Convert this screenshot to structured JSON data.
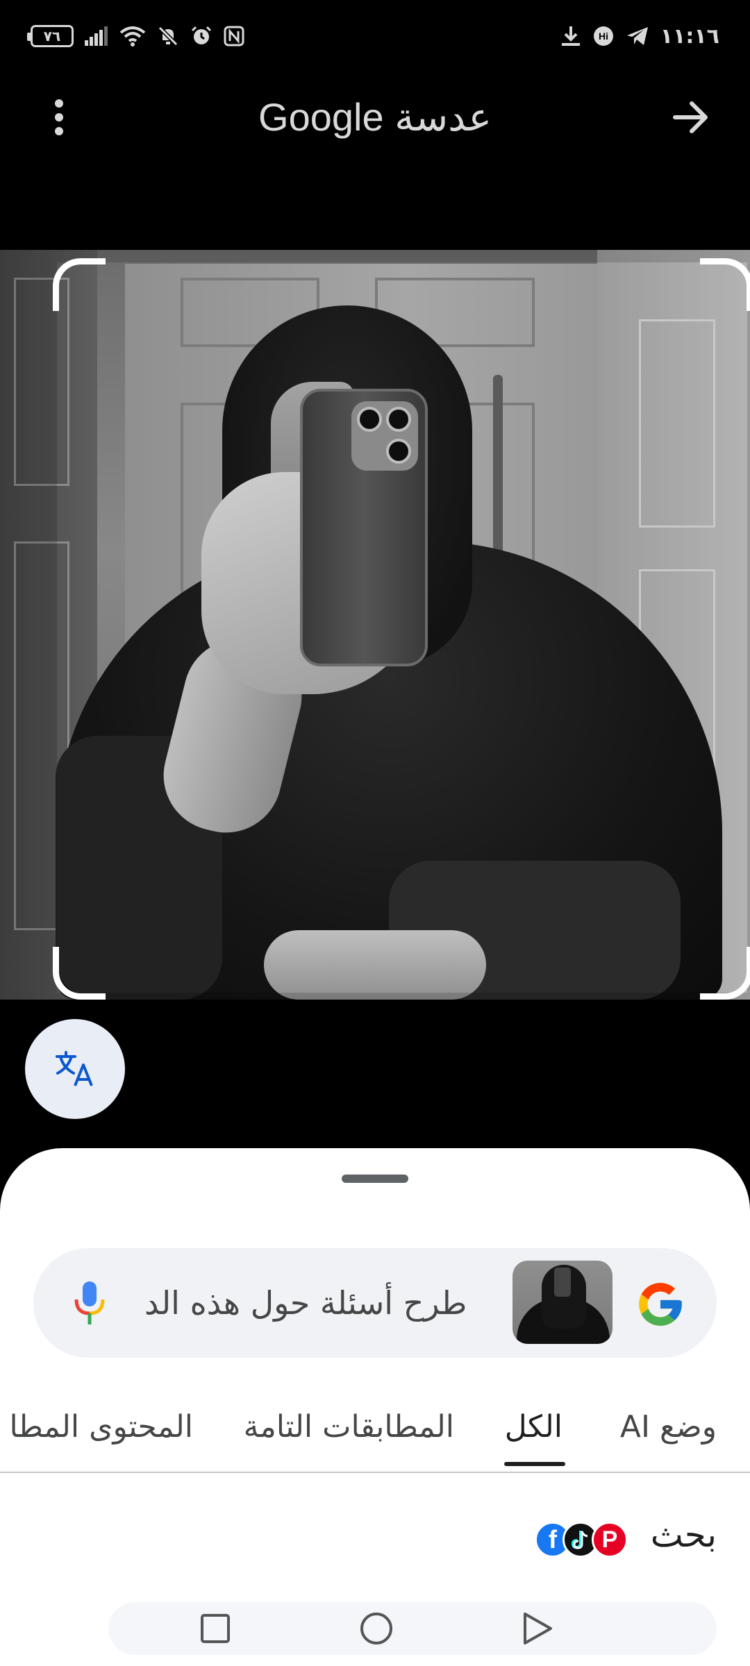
{
  "status_bar": {
    "time": "١١:١٦",
    "battery_level": "٧٦"
  },
  "appbar": {
    "title_google": "Google",
    "title_lens": "عدسة"
  },
  "search": {
    "placeholder": "طرح أسئلة حول هذه الد"
  },
  "tabs": [
    {
      "label": "وضع AI"
    },
    {
      "label": "الكل"
    },
    {
      "label": "المطابقات التامة"
    },
    {
      "label": "المحتوى المطا"
    }
  ],
  "sources": {
    "label": "بحث"
  },
  "colors": {
    "sheet_bg": "#ffffff",
    "search_bg": "#f0f2f5",
    "fab_bg": "#e9eef6",
    "translate_blue": "#0b57d0",
    "facebook": "#1877f2",
    "tiktok": "#111111",
    "pinterest": "#e60023"
  }
}
